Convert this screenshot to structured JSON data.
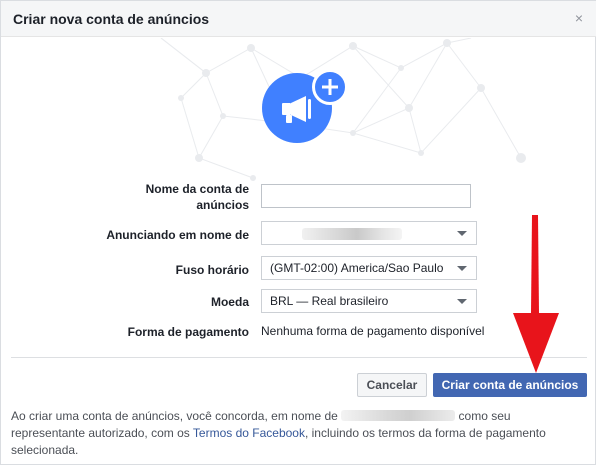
{
  "dialog": {
    "title": "Criar nova conta de anúncios",
    "close_glyph": "×"
  },
  "form": {
    "account_name_label": "Nome da conta de anúncios",
    "advertising_for_label": "Anunciando em nome de",
    "timezone_label": "Fuso horário",
    "timezone_value": "(GMT-02:00) America/Sao Paulo",
    "currency_label": "Moeda",
    "currency_value": "BRL — Real brasileiro",
    "payment_label": "Forma de pagamento",
    "payment_value": "Nenhuma forma de pagamento disponível"
  },
  "buttons": {
    "cancel_label": "Cancelar",
    "create_label": "Criar conta de anúncios"
  },
  "terms": {
    "part1": "Ao criar uma conta de anúncios, você concorda, em nome de",
    "part2": "como seu representante autorizado, com os",
    "link": "Termos do Facebook",
    "part3": ", incluindo os termos da forma de pagamento selecionada."
  },
  "icons": {
    "close": "close-icon",
    "hero": "megaphone-icon",
    "plus": "plus-icon",
    "caret": "chevron-down-icon"
  },
  "colors": {
    "accent": "#4267b2",
    "hero_blue": "#4080ff",
    "annotation_arrow": "#e8141b"
  }
}
